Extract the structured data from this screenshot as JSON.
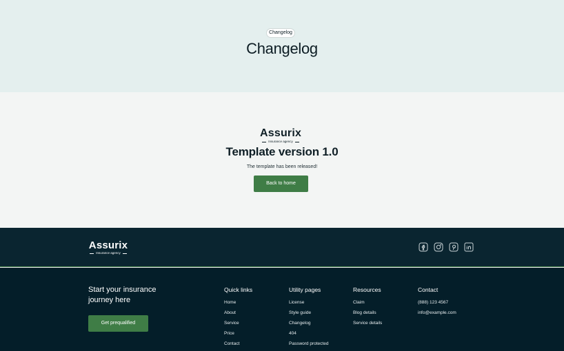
{
  "hero": {
    "badge": "Changelog",
    "title": "Changelog"
  },
  "brand": {
    "name": "Assurix",
    "tagline": "Insurance agency"
  },
  "release": {
    "title": "Template version 1.0",
    "description": "The template has been released!",
    "button_label": "Back to home"
  },
  "socials": [
    "facebook-icon",
    "instagram-icon",
    "pinterest-icon",
    "linkedin-icon"
  ],
  "footer": {
    "cta_title": "Start your insurance journey here",
    "cta_button": "Get prequalified",
    "columns": [
      {
        "title": "Quick links",
        "links": [
          "Home",
          "About",
          "Service",
          "Price",
          "Contact"
        ]
      },
      {
        "title": "Utility pages",
        "links": [
          "License",
          "Style guide",
          "Changelog",
          "404",
          "Password protected"
        ]
      },
      {
        "title": "Resources",
        "links": [
          "Claim",
          "Blog details",
          "Service details"
        ]
      },
      {
        "title": "Contact",
        "links": [
          "(888) 123 4567",
          "info@example.com"
        ]
      }
    ]
  },
  "colors": {
    "hero_bg": "#e4efee",
    "main_bg": "#f3f5f4",
    "footer_top_bg": "#0a2530",
    "footer_bottom_bg": "#041e29",
    "accent": "#3f7d46"
  }
}
